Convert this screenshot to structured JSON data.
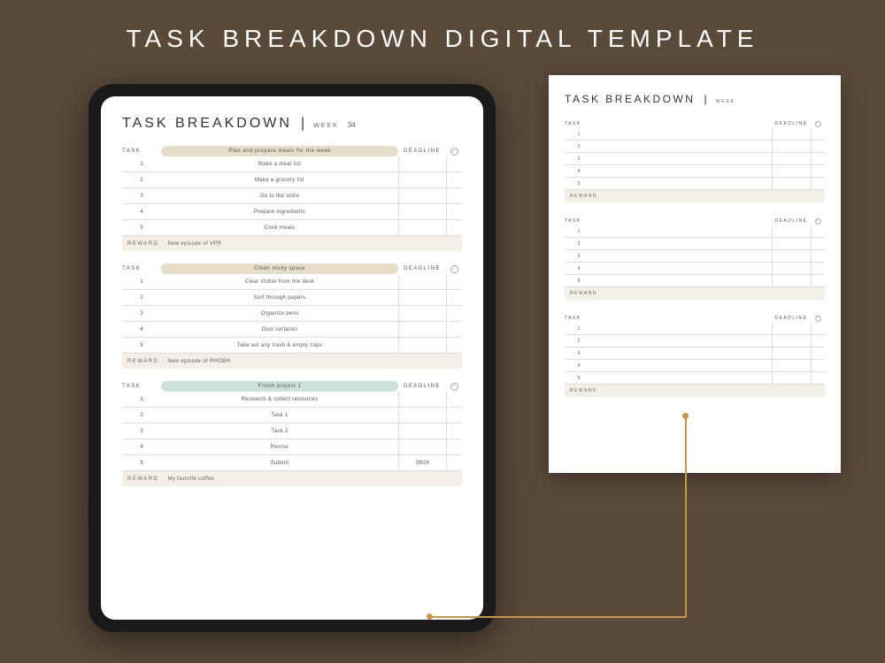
{
  "page_title": "TASK BREAKDOWN DIGITAL TEMPLATE",
  "planner": {
    "title": "TASK BREAKDOWN",
    "divider": "|",
    "week_label": "WEEK",
    "week_number": "34",
    "columns": {
      "task": "TASK",
      "deadline": "DEADLINE",
      "check": "✓"
    },
    "reward_label": "REWARD",
    "blocks": [
      {
        "task_title": "Plan and prepare meals for the week",
        "chip_color": "beige",
        "subtasks": [
          {
            "num": "1",
            "text": "Make a meal list",
            "deadline": ""
          },
          {
            "num": "2",
            "text": "Make a grocery list",
            "deadline": ""
          },
          {
            "num": "3",
            "text": "Go to the store",
            "deadline": ""
          },
          {
            "num": "4",
            "text": "Prepare ingredients",
            "deadline": ""
          },
          {
            "num": "5",
            "text": "Cook meals",
            "deadline": ""
          }
        ],
        "reward": "New episode of VPR"
      },
      {
        "task_title": "Clean study space",
        "chip_color": "beige",
        "subtasks": [
          {
            "num": "1",
            "text": "Clear clutter from the desk",
            "deadline": ""
          },
          {
            "num": "2",
            "text": "Sort through papers",
            "deadline": ""
          },
          {
            "num": "3",
            "text": "Organize pens",
            "deadline": ""
          },
          {
            "num": "4",
            "text": "Dust surfaces",
            "deadline": ""
          },
          {
            "num": "5",
            "text": "Take out any trash & empty cups",
            "deadline": ""
          }
        ],
        "reward": "New episode of RHOBH"
      },
      {
        "task_title": "Finish project 1",
        "chip_color": "teal",
        "subtasks": [
          {
            "num": "1",
            "text": "Research & collect resources",
            "deadline": ""
          },
          {
            "num": "2",
            "text": "Task 1",
            "deadline": ""
          },
          {
            "num": "3",
            "text": "Task 2",
            "deadline": ""
          },
          {
            "num": "4",
            "text": "Revise",
            "deadline": ""
          },
          {
            "num": "5",
            "text": "Submit",
            "deadline": "08/24"
          }
        ],
        "reward": "My favorite coffee"
      }
    ]
  },
  "blank_template": {
    "title": "TASK BREAKDOWN",
    "divider": "|",
    "week_label": "WEEK",
    "columns": {
      "task": "TASK",
      "deadline": "DEADLINE"
    },
    "reward_label": "REWARD",
    "blocks": [
      {
        "subtasks": [
          {
            "num": "1"
          },
          {
            "num": "2"
          },
          {
            "num": "3"
          },
          {
            "num": "4"
          },
          {
            "num": "5"
          }
        ]
      },
      {
        "subtasks": [
          {
            "num": "1"
          },
          {
            "num": "2"
          },
          {
            "num": "3"
          },
          {
            "num": "4"
          },
          {
            "num": "5"
          }
        ]
      },
      {
        "subtasks": [
          {
            "num": "1"
          },
          {
            "num": "2"
          },
          {
            "num": "3"
          },
          {
            "num": "4"
          },
          {
            "num": "5"
          }
        ]
      }
    ]
  }
}
